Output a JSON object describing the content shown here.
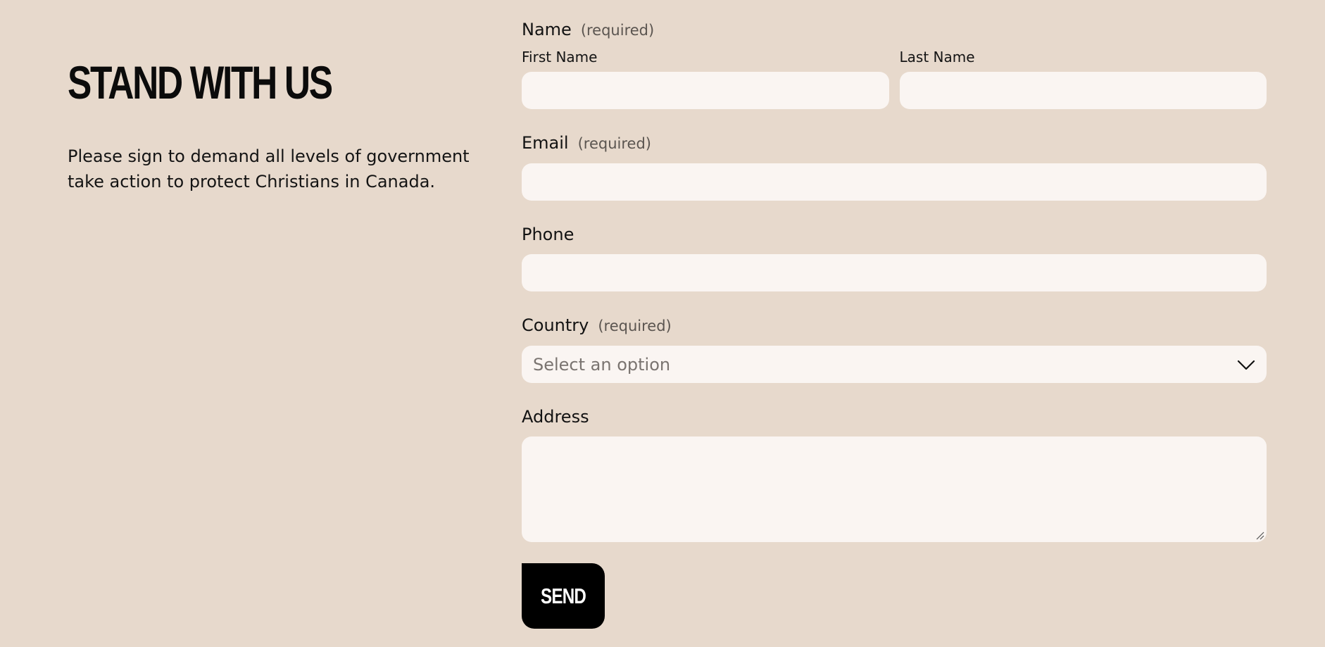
{
  "heading": "STAND WITH US",
  "intro": "Please sign to demand all levels of government take action to protect Christians in Canada.",
  "form": {
    "name": {
      "label": "Name",
      "required": "(required)",
      "first_label": "First Name",
      "first_value": "",
      "last_label": "Last Name",
      "last_value": ""
    },
    "email": {
      "label": "Email",
      "required": "(required)",
      "value": ""
    },
    "phone": {
      "label": "Phone",
      "value": ""
    },
    "country": {
      "label": "Country",
      "required": "(required)",
      "selected": "Select an option",
      "icon": "chevron-down-icon"
    },
    "address": {
      "label": "Address",
      "value": ""
    },
    "send_label": "SEND"
  },
  "colors": {
    "background": "#e7d9cc",
    "field": "#faf5f2",
    "button": "#000000",
    "text": "#111111",
    "muted": "#5b5550"
  }
}
